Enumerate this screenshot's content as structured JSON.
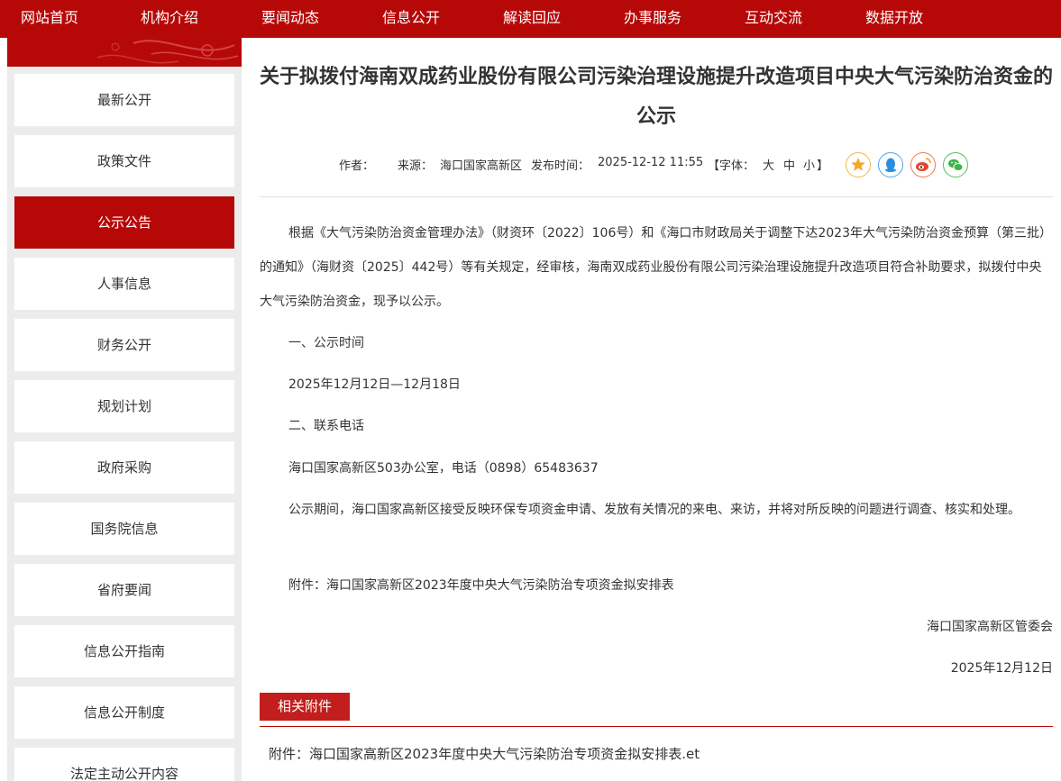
{
  "nav": {
    "items": [
      "网站首页",
      "机构介绍",
      "要闻动态",
      "信息公开",
      "解读回应",
      "办事服务",
      "互动交流",
      "数据开放"
    ]
  },
  "sidebar": {
    "items": [
      {
        "label": "最新公开"
      },
      {
        "label": "政策文件"
      },
      {
        "label": "公示公告"
      },
      {
        "label": "人事信息"
      },
      {
        "label": "财务公开"
      },
      {
        "label": "规划计划"
      },
      {
        "label": "政府采购"
      },
      {
        "label": "国务院信息"
      },
      {
        "label": "省府要闻"
      },
      {
        "label": "信息公开指南"
      },
      {
        "label": "信息公开制度"
      },
      {
        "label": "法定主动公开内容"
      }
    ],
    "active_index": 2
  },
  "article": {
    "title": "关于拟拨付海南双成药业股份有限公司污染治理设施提升改造项目中央大气污染防治资金的公示",
    "meta": {
      "author_label": "作者：",
      "source_label": "来源：",
      "source": "海口国家高新区",
      "publish_label": "发布时间：",
      "publish_time": "2025-12-12 11:55",
      "font_label": "【字体：",
      "font_large": "大",
      "font_medium": "中",
      "font_small": "小",
      "font_close": "】"
    },
    "share_icons": [
      "favorite-icon",
      "qq-icon",
      "weibo-icon",
      "wechat-icon"
    ],
    "p1": "根据《大气污染防治资金管理办法》（财资环〔2022〕106号）和《海口市财政局关于调整下达2023年大气污染防治资金预算（第三批）的通知》（海财资〔2025〕442号）等有关规定，经审核，海南双成药业股份有限公司污染治理设施提升改造项目符合补助要求，拟拨付中央大气污染防治资金，现予以公示。",
    "h1": "一、公示时间",
    "p2": "2025年12月12日—12月18日",
    "h2": "二、联系电话",
    "p3": "海口国家高新区503办公室，电话（0898）65483637",
    "p4": "公示期间，海口国家高新区接受反映环保专项资金申请、发放有关情况的来电、来访，并将对所反映的问题进行调查、核实和处理。",
    "p5": "附件：海口国家高新区2023年度中央大气污染防治专项资金拟安排表",
    "signature": "海口国家高新区管委会",
    "date": "2025年12月12日"
  },
  "attachments": {
    "tab_label": "相关附件",
    "item_prefix": "附件：",
    "item_name": "海口国家高新区2023年度中央大气污染防治专项资金拟安排表.et"
  },
  "colors": {
    "brand_red": "#b70808",
    "tab_red": "#c21e1e",
    "sidebar_bg": "#ececec"
  }
}
